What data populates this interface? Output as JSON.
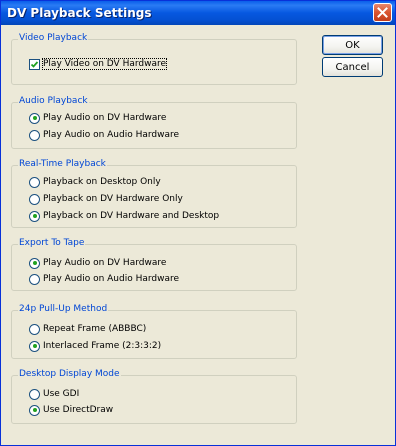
{
  "window": {
    "title": "DV Playback Settings",
    "close_icon": "close-icon"
  },
  "buttons": {
    "ok": "OK",
    "cancel": "Cancel"
  },
  "groups": {
    "video_playback": {
      "legend": "Video Playback",
      "options": [
        {
          "label": "Play Video on DV Hardware",
          "checked": true
        }
      ]
    },
    "audio_playback": {
      "legend": "Audio Playback",
      "options": [
        {
          "label": "Play Audio on DV Hardware",
          "selected": true
        },
        {
          "label": "Play Audio on Audio Hardware",
          "selected": false
        }
      ]
    },
    "realtime_playback": {
      "legend": "Real-Time Playback",
      "options": [
        {
          "label": "Playback on Desktop Only",
          "selected": false
        },
        {
          "label": "Playback on DV Hardware Only",
          "selected": false
        },
        {
          "label": "Playback on DV Hardware and Desktop",
          "selected": true
        }
      ]
    },
    "export_to_tape": {
      "legend": "Export To Tape",
      "options": [
        {
          "label": "Play Audio on DV Hardware",
          "selected": true
        },
        {
          "label": "Play Audio on Audio Hardware",
          "selected": false
        }
      ]
    },
    "pulldown": {
      "legend": "24p Pull-Up Method",
      "options": [
        {
          "label": "Repeat Frame (ABBBC)",
          "selected": false
        },
        {
          "label": "Interlaced Frame (2:3:3:2)",
          "selected": true
        }
      ]
    },
    "desktop_display": {
      "legend": "Desktop Display Mode",
      "options": [
        {
          "label": "Use GDI",
          "selected": false
        },
        {
          "label": "Use DirectDraw",
          "selected": true
        }
      ]
    }
  },
  "colors": {
    "titlebar": "#0058E0",
    "legend": "#0046D5",
    "radio_dot": "#21A121",
    "dialog_bg": "#ECE9D8"
  }
}
